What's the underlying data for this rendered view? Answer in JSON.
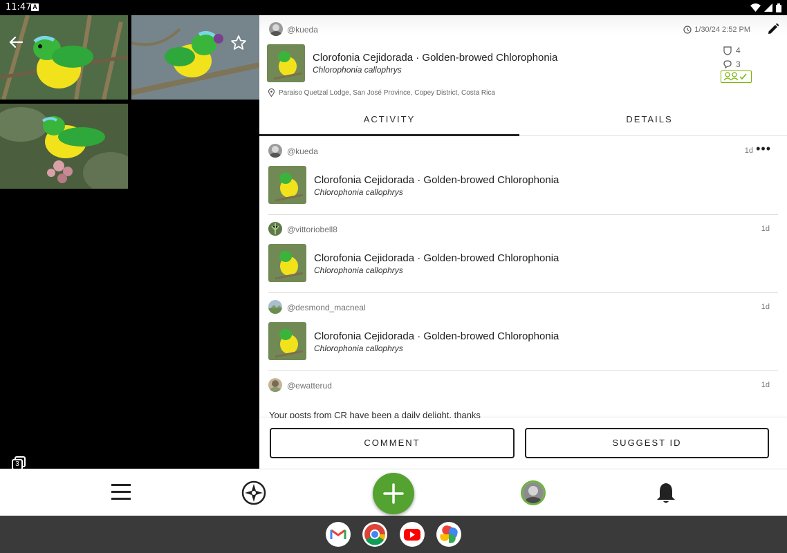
{
  "status_bar": {
    "time": "11:47"
  },
  "photos": {
    "count": "3"
  },
  "observation": {
    "username": "@kueda",
    "datetime": "1/30/24 2:52 PM",
    "common_name": "Clorofonia Cejidorada · Golden-browed Chlorophonia",
    "scientific_name": "Chlorophonia callophrys",
    "identifications_count": "4",
    "comments_count": "3",
    "location": "Paraiso Quetzal Lodge, San José Province, Copey District, Costa Rica"
  },
  "tabs": [
    {
      "label": "ACTIVITY",
      "active": true
    },
    {
      "label": "DETAILS",
      "active": false
    }
  ],
  "activity": [
    {
      "username": "@kueda",
      "ago": "1d",
      "common_name": "Clorofonia Cejidorada · Golden-browed Chlorophonia",
      "scientific_name": "Chlorophonia callophrys"
    },
    {
      "username": "@vittoriobell8",
      "ago": "1d",
      "common_name": "Clorofonia Cejidorada · Golden-browed Chlorophonia",
      "scientific_name": "Chlorophonia callophrys"
    },
    {
      "username": "@desmond_macneal",
      "ago": "1d",
      "common_name": "Clorofonia Cejidorada · Golden-browed Chlorophonia",
      "scientific_name": "Chlorophonia callophrys"
    },
    {
      "username": "@ewatterud",
      "ago": "1d",
      "comment": "Your posts from CR have been a daily delight, thanks"
    }
  ],
  "actions": {
    "comment_label": "COMMENT",
    "suggest_label": "SUGGEST ID"
  },
  "nav": {
    "icons": [
      "menu-icon",
      "explore-compass-icon",
      "add-observation-icon",
      "profile-avatar",
      "notifications-bell-icon"
    ]
  },
  "dock": {
    "apps": [
      "gmail-icon",
      "chrome-icon",
      "youtube-icon",
      "google-photos-icon"
    ]
  },
  "colors": {
    "accent_green": "#54a331",
    "research_grade": "#77b300"
  }
}
